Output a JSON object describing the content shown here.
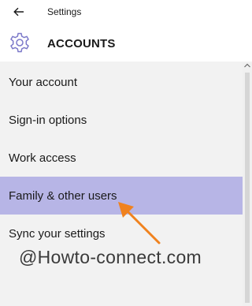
{
  "window": {
    "title": "Settings"
  },
  "header": {
    "section_title": "ACCOUNTS"
  },
  "nav": {
    "items": [
      {
        "label": "Your account",
        "selected": false
      },
      {
        "label": "Sign-in options",
        "selected": false
      },
      {
        "label": "Work access",
        "selected": false
      },
      {
        "label": "Family & other users",
        "selected": true
      },
      {
        "label": "Sync your settings",
        "selected": false
      }
    ]
  },
  "watermark": {
    "text": "@Howto-connect.com"
  },
  "icons": {
    "back": "back-arrow-icon",
    "settings": "gear-icon",
    "pointer": "orange-arrow-annotation"
  },
  "colors": {
    "selected_bg": "#b7b5e6",
    "pane_bg": "#f2f2f2",
    "header_bg": "#ffffff",
    "accent_arrow": "#f0821e",
    "gear": "#7b78c9"
  }
}
